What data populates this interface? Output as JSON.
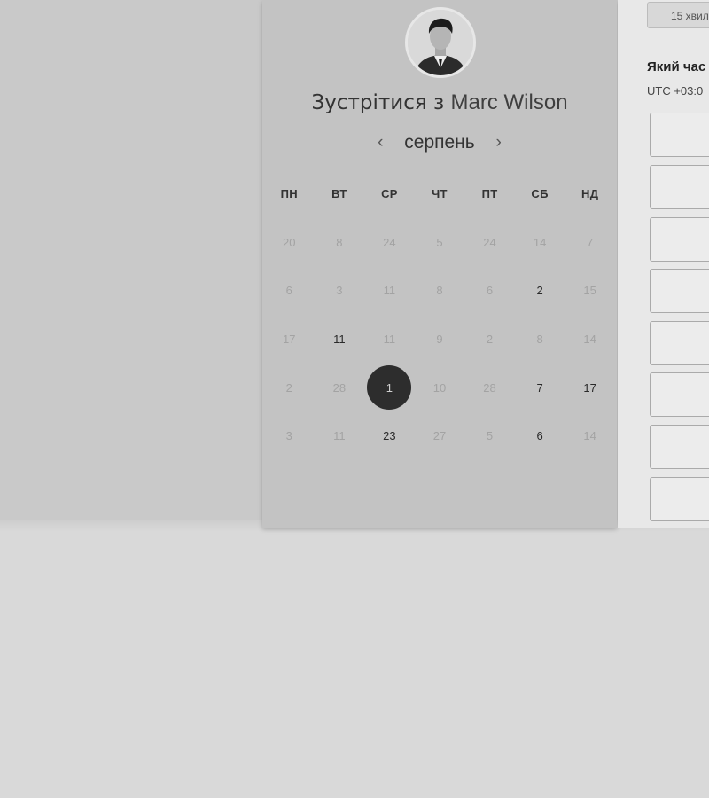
{
  "header": {
    "title_prefix": "Зустрітися з",
    "host_name": "Marc Wilson"
  },
  "calendar": {
    "month": "серпень",
    "prev_icon": "chevron-left-icon",
    "next_icon": "chevron-right-icon",
    "weekdays": [
      "ПН",
      "ВТ",
      "СР",
      "ЧТ",
      "ПТ",
      "СБ",
      "НД"
    ],
    "weeks": [
      [
        "20",
        "8",
        "24",
        "5",
        "24",
        "14",
        "7"
      ],
      [
        "6",
        "3",
        "11",
        "8",
        "6",
        "2",
        "15"
      ],
      [
        "17",
        "11",
        "11",
        "9",
        "2",
        "8",
        "14"
      ],
      [
        "2",
        "28",
        "1",
        "10",
        "28",
        "7",
        "17"
      ],
      [
        "3",
        "11",
        "23",
        "27",
        "5",
        "6",
        "14"
      ]
    ],
    "available_days": [
      "2",
      "11",
      "7",
      "17",
      "23",
      "6"
    ],
    "selected_day": "1"
  },
  "side_panel": {
    "duration_label": "15 хвил",
    "question": "Який час",
    "timezone": "UTC +03:0"
  },
  "colors": {
    "selected_day_bg": "#2d2d2d",
    "card_bg": "#c3c3c3",
    "page_bg": "#d9d9d9"
  }
}
